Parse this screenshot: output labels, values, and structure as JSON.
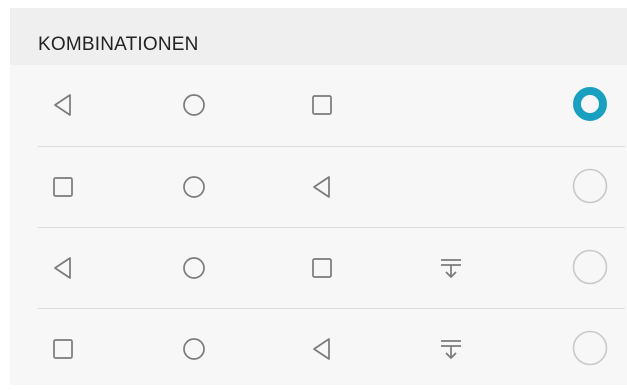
{
  "section": {
    "title": "KOMBINATIONEN"
  },
  "combinations": [
    {
      "buttons": [
        "back-icon",
        "home-icon",
        "recents-icon"
      ],
      "selected": true
    },
    {
      "buttons": [
        "recents-icon",
        "home-icon",
        "back-icon"
      ],
      "selected": false
    },
    {
      "buttons": [
        "back-icon",
        "home-icon",
        "recents-icon",
        "notification-pulldown-icon"
      ],
      "selected": false
    },
    {
      "buttons": [
        "recents-icon",
        "home-icon",
        "back-icon",
        "notification-pulldown-icon"
      ],
      "selected": false
    }
  ],
  "colors": {
    "accent": "#19a0c0",
    "icon": "#7a7a7a",
    "radio_off": "#c8c8c8"
  }
}
